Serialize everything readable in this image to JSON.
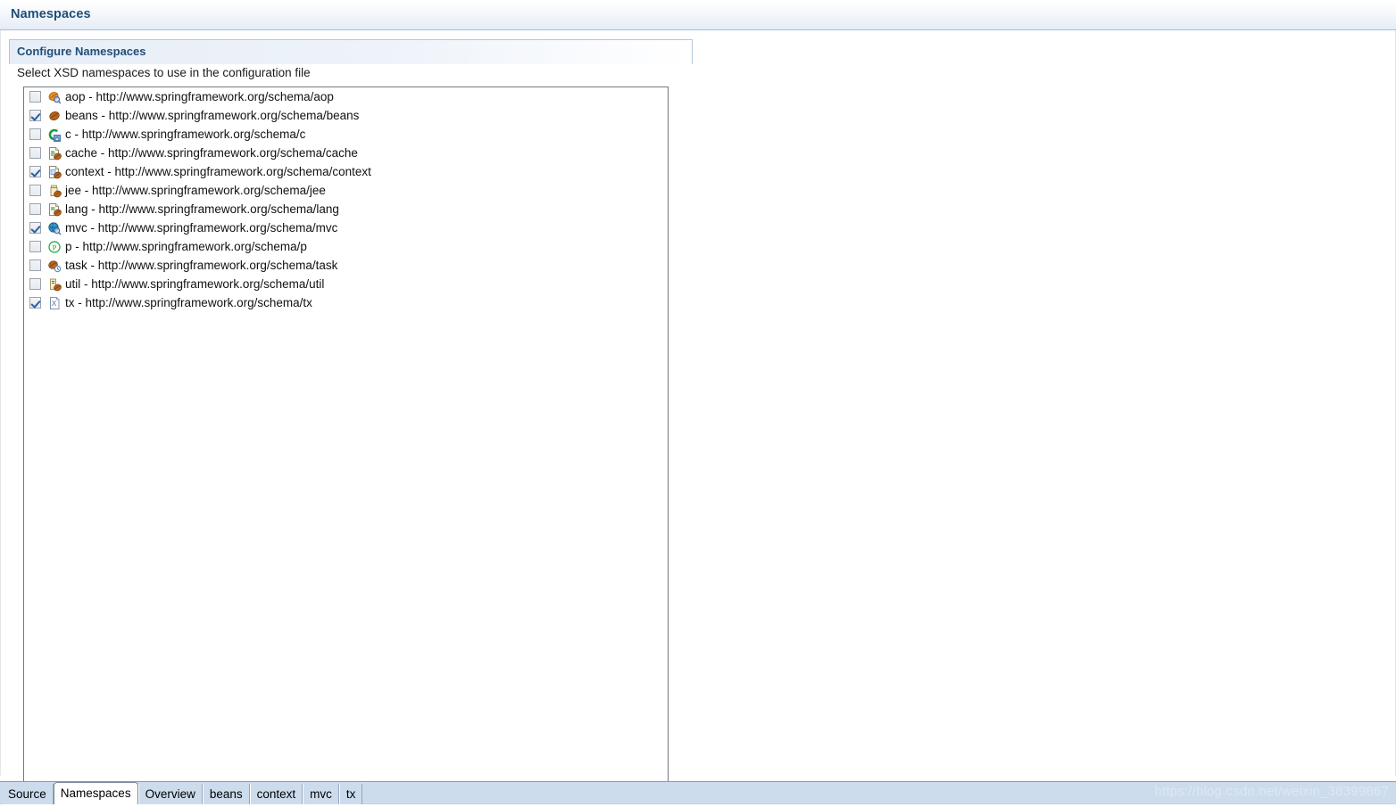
{
  "form": {
    "title": "Namespaces"
  },
  "section": {
    "title": "Configure Namespaces",
    "description": "Select XSD namespaces to use in the configuration file"
  },
  "namespaces": [
    {
      "prefix": "aop",
      "sep": " - ",
      "uri": "http://www.springframework.org/schema/aop",
      "checked": false,
      "icon": "aop-namespace-icon"
    },
    {
      "prefix": "beans",
      "sep": " - ",
      "uri": "http://www.springframework.org/schema/beans",
      "checked": true,
      "icon": "beans-namespace-icon"
    },
    {
      "prefix": "c",
      "sep": " - ",
      "uri": "http://www.springframework.org/schema/c",
      "checked": false,
      "icon": "c-namespace-icon"
    },
    {
      "prefix": "cache",
      "sep": " - ",
      "uri": "http://www.springframework.org/schema/cache",
      "checked": false,
      "icon": "cache-namespace-icon"
    },
    {
      "prefix": "context",
      "sep": " - ",
      "uri": "http://www.springframework.org/schema/context",
      "checked": true,
      "icon": "context-namespace-icon"
    },
    {
      "prefix": "jee",
      "sep": " - ",
      "uri": "http://www.springframework.org/schema/jee",
      "checked": false,
      "icon": "jee-namespace-icon"
    },
    {
      "prefix": "lang",
      "sep": " - ",
      "uri": "http://www.springframework.org/schema/lang",
      "checked": false,
      "icon": "lang-namespace-icon"
    },
    {
      "prefix": "mvc",
      "sep": " - ",
      "uri": "http://www.springframework.org/schema/mvc",
      "checked": true,
      "icon": "mvc-namespace-icon"
    },
    {
      "prefix": "p",
      "sep": " - ",
      "uri": "http://www.springframework.org/schema/p",
      "checked": false,
      "icon": "p-namespace-icon"
    },
    {
      "prefix": "task",
      "sep": " - ",
      "uri": "http://www.springframework.org/schema/task",
      "checked": false,
      "icon": "task-namespace-icon"
    },
    {
      "prefix": "util",
      "sep": " - ",
      "uri": "http://www.springframework.org/schema/util",
      "checked": false,
      "icon": "util-namespace-icon"
    },
    {
      "prefix": "tx",
      "sep": " - ",
      "uri": "http://www.springframework.org/schema/tx",
      "checked": true,
      "icon": "tx-namespace-icon"
    }
  ],
  "tabs": [
    {
      "label": "Source",
      "active": false
    },
    {
      "label": "Namespaces",
      "active": true
    },
    {
      "label": "Overview",
      "active": false
    },
    {
      "label": "beans",
      "active": false
    },
    {
      "label": "context",
      "active": false
    },
    {
      "label": "mvc",
      "active": false
    },
    {
      "label": "tx",
      "active": false
    }
  ],
  "watermark": {
    "text": "https://blog.csdn.net/weixin_38399867"
  },
  "colors": {
    "header_title": "#1f4e79",
    "section_border": "#b3c6dd",
    "list_border": "#73797f",
    "tabbar_bg": "#cddced",
    "checkbox_check": "#2b5ea8",
    "watermark": "#dde7f3"
  }
}
